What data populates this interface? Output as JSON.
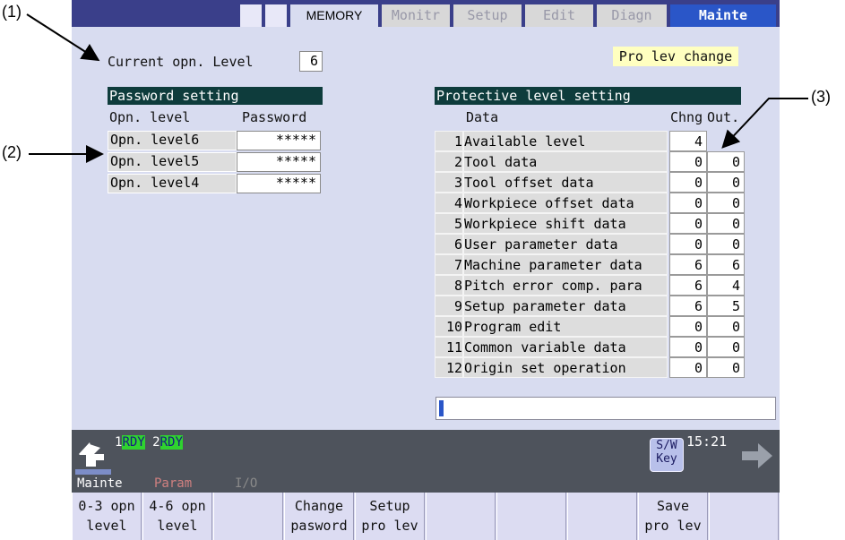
{
  "callouts": {
    "c1": "(1)",
    "c2": "(2)",
    "c3": "(3)"
  },
  "tabs": {
    "memory": "MEMORY",
    "items": [
      "Monitr",
      "Setup",
      "Edit",
      "Diagn",
      "Mainte"
    ],
    "active": "Mainte"
  },
  "current_level": {
    "label": "Current opn. Level",
    "value": "6"
  },
  "pro_lev_change": "Pro lev change",
  "password_setting": {
    "title": "Password setting",
    "col_level": "Opn. level",
    "col_password": "Password",
    "rows": [
      {
        "level": "Opn. level6",
        "password": "*****"
      },
      {
        "level": "Opn. level5",
        "password": "*****"
      },
      {
        "level": "Opn. level4",
        "password": "*****"
      }
    ]
  },
  "protective_setting": {
    "title": "Protective level setting",
    "col_data": "Data",
    "col_chng": "Chng",
    "col_out": "Out.",
    "rows": [
      {
        "no": "1",
        "data": "Available level",
        "chng": "4",
        "out": ""
      },
      {
        "no": "2",
        "data": "Tool data",
        "chng": "0",
        "out": "0"
      },
      {
        "no": "3",
        "data": "Tool offset data",
        "chng": "0",
        "out": "0"
      },
      {
        "no": "4",
        "data": "Workpiece offset data",
        "chng": "0",
        "out": "0"
      },
      {
        "no": "5",
        "data": "Workpiece shift data",
        "chng": "0",
        "out": "0"
      },
      {
        "no": "6",
        "data": "User parameter data",
        "chng": "0",
        "out": "0"
      },
      {
        "no": "7",
        "data": "Machine parameter data",
        "chng": "6",
        "out": "6"
      },
      {
        "no": "8",
        "data": "Pitch error comp. para",
        "chng": "6",
        "out": "4"
      },
      {
        "no": "9",
        "data": "Setup parameter data",
        "chng": "6",
        "out": "5"
      },
      {
        "no": "10",
        "data": "Program edit",
        "chng": "0",
        "out": "0"
      },
      {
        "no": "11",
        "data": "Common variable data",
        "chng": "0",
        "out": "0"
      },
      {
        "no": "12",
        "data": "Origin set operation",
        "chng": "0",
        "out": "0"
      }
    ]
  },
  "input_line": {
    "value": ""
  },
  "status": {
    "sys1_num": "1",
    "sys1_state": "RDY",
    "sys2_num": "2",
    "sys2_state": "RDY",
    "sw_key": "S/W Key",
    "time": "15:21"
  },
  "mode_tabs": [
    "Mainte",
    "Param",
    "I/O"
  ],
  "softkeys": [
    {
      "l1": "0-3 opn",
      "l2": "level"
    },
    {
      "l1": "4-6 opn",
      "l2": "level"
    },
    {
      "l1": "",
      "l2": ""
    },
    {
      "l1": "Change",
      "l2": "pasword"
    },
    {
      "l1": "Setup",
      "l2": "pro lev"
    },
    {
      "l1": "",
      "l2": ""
    },
    {
      "l1": "",
      "l2": ""
    },
    {
      "l1": "",
      "l2": ""
    },
    {
      "l1": "Save",
      "l2": "pro lev"
    },
    {
      "l1": "",
      "l2": ""
    }
  ],
  "colors": {
    "header": "#0e3c3c",
    "active_tab": "#2a56c8",
    "rdy": "#2fd22f",
    "highlight": "#ffffc0"
  }
}
